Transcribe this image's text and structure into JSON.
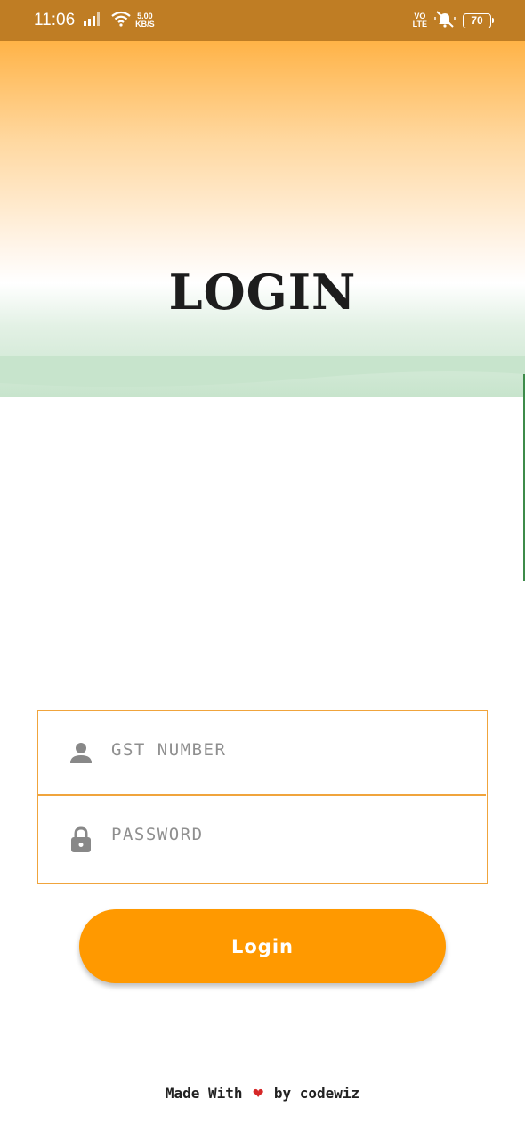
{
  "status_bar": {
    "time": "11:06",
    "speed_value": "5.00",
    "speed_unit": "KB/S",
    "network_top": "VO",
    "network_bottom": "LTE",
    "battery": "70",
    "icons": [
      "signal-icon",
      "wifi-icon",
      "mute-vibrate-icon",
      "battery-icon"
    ]
  },
  "header": {
    "title": "LOGIN",
    "gradient_colors": [
      "#ffb347",
      "#ffffff",
      "#c7e4cc"
    ]
  },
  "form": {
    "gst_placeholder": "GST NUMBER",
    "password_placeholder": "PASSWORD",
    "border_color": "#f0a43c",
    "icon_color": "#888888"
  },
  "login_button": {
    "label": "Login",
    "color": "#ff9900"
  },
  "footer": {
    "made_with": "Made With",
    "heart": "❤",
    "by": "by codewiz"
  }
}
